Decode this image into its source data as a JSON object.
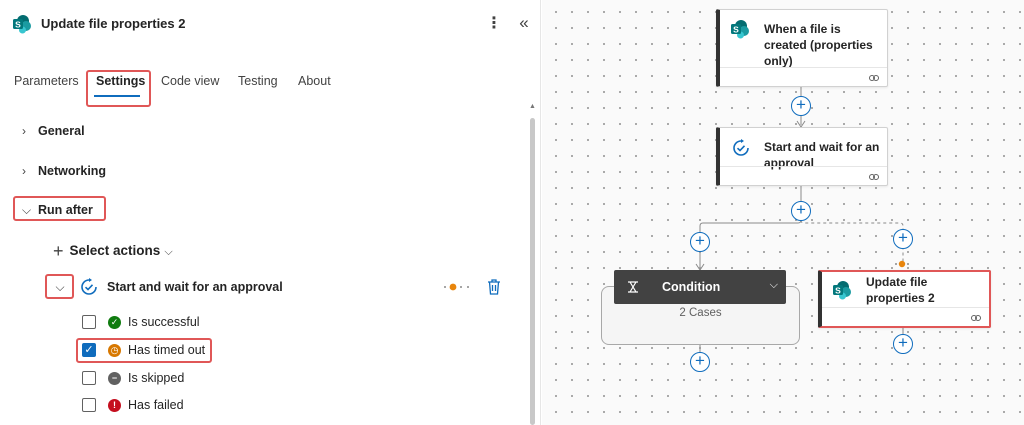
{
  "panel": {
    "title": "Update file properties 2",
    "tabs": [
      "Parameters",
      "Settings",
      "Code view",
      "Testing",
      "About"
    ],
    "active_tab": "Settings",
    "sections": {
      "general": "General",
      "networking": "Networking",
      "run_after": "Run after"
    },
    "select_actions": "Select actions",
    "run_after_action": "Start and wait for an approval",
    "statuses": [
      {
        "label": "Is successful",
        "checked": false,
        "color": "#107c10",
        "glyph": "✓"
      },
      {
        "label": "Has timed out",
        "checked": true,
        "color": "#d77800",
        "glyph": "◷"
      },
      {
        "label": "Is skipped",
        "checked": false,
        "color": "#616161",
        "glyph": "−"
      },
      {
        "label": "Has failed",
        "checked": false,
        "color": "#c50f1f",
        "glyph": "!"
      }
    ],
    "icons": [
      "sharepoint-icon",
      "more-options-icon",
      "collapse-icon",
      "chevron-right-icon",
      "chevron-down-icon",
      "plus-icon",
      "approval-icon",
      "trash-icon",
      "checkmark-icon"
    ]
  },
  "canvas": {
    "trigger_title": "When a file is created (properties only)",
    "approval_title": "Start and wait for an approval",
    "condition_label": "Condition",
    "condition_cases": "2 Cases",
    "update_title": "Update file properties 2"
  },
  "colors": {
    "accent": "#0f6cbd",
    "highlight": "#e05757",
    "sharepoint": "#03787c",
    "status_orange": "#e8850c"
  }
}
